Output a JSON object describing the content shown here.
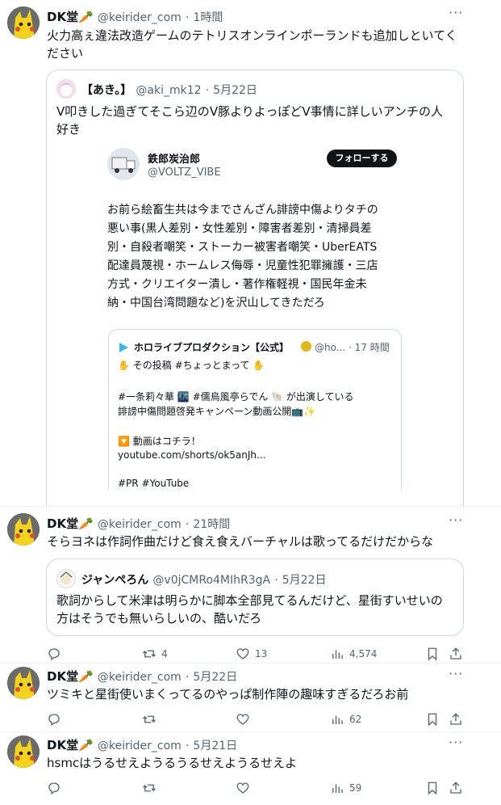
{
  "tweets": [
    {
      "name": "DK堂🥕",
      "handle": "@keirider_com",
      "time": "1時間",
      "text_lines": [
        "火力高ぇ違法改造ゲームのテトリスオンラインポーランドも追加しといてく",
        "ださい"
      ],
      "quote": {
        "name": "【あき。】",
        "handle": "@aki_mk12",
        "time": "5月22日",
        "text_lines": [
          "V叩きした過ぎてそこら辺のV豚よりよっぽどV事情に詳しいアンチの人",
          "好き"
        ],
        "embed": {
          "name": "鉄郎炭治郎",
          "handle": "@VOLTZ_VIBE",
          "follow_label": "フォローする",
          "text_lines": [
            "お前ら絵畜生共は今までさんざん誹謗中傷よりタチの",
            "悪い事(黒人差別・女性差別・障害者差別・清掃員差",
            "別・自殺者嘲笑・ストーカー被害者嘲笑・UberEATS",
            "配達員蔑視・ホームレス侮辱・児童性犯罪擁護・三店",
            "方式・クリエイター潰し・著作権軽視・国民年金未",
            "納・中国台湾問題など)を沢山してきただろ"
          ],
          "inner": {
            "name": "ホロライブプロダクション【公式】",
            "handle_time": "@ho... · 17 時間",
            "text_lines": [
              "✋ その投稿 #ちょっとまって ✋",
              "",
              "#一条莉々華 🌃 #儒烏風亭らでん 🐚 が出演している",
              "誹謗中傷問題啓発キャンペーン動画公開📺✨",
              "",
              "🔽 動画はコチラ！",
              "youtube.com/shorts/ok5anJh...",
              "",
              "#PR #YouTube"
            ]
          }
        }
      }
    },
    {
      "name": "DK堂🥕",
      "handle": "@keirider_com",
      "time": "21時間",
      "text_lines": [
        "そらヨネは作詞作曲だけど食え食えバーチャルは歌ってるだけだからな"
      ],
      "quote": {
        "name": "ジャンぺろん",
        "handle": "@v0jCMRo4MIhR3gA",
        "time": "5月22日",
        "text_lines": [
          "歌詞からして米津は明らかに脚本全部見てるんだけど、星街すいせいの",
          "方はそうでも無いらしいの、酷いだろ"
        ]
      },
      "actions": {
        "reply": "",
        "retweet": "4",
        "like": "13",
        "views": "4,574"
      }
    },
    {
      "name": "DK堂🥕",
      "handle": "@keirider_com",
      "time": "5月22日",
      "text_lines": [
        "ツミキと星街使いまくってるのやっぱ制作陣の趣味すぎるだろお前"
      ],
      "actions": {
        "reply": "",
        "retweet": "",
        "like": "",
        "views": "62"
      }
    },
    {
      "name": "DK堂🥕",
      "handle": "@keirider_com",
      "time": "5月21日",
      "text_lines": [
        "hsmcはうるせえようるうるせえようるせえよ"
      ],
      "actions": {
        "reply": "",
        "retweet": "",
        "like": "",
        "views": "59"
      }
    }
  ],
  "separator": "·",
  "more_glyph": "···"
}
